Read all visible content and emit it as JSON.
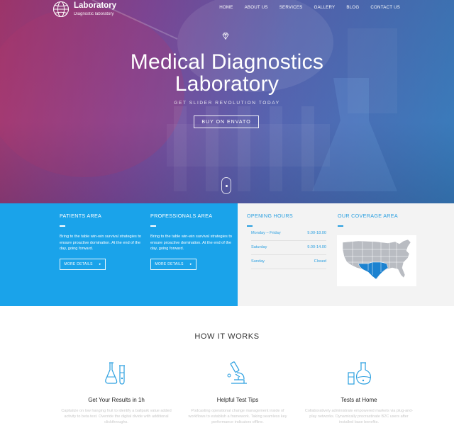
{
  "header": {
    "logo_title": "Laboratory",
    "logo_subtitle": "Diagnostic laboratory",
    "nav": [
      "HOME",
      "ABOUT US",
      "SERVICES",
      "GALLERY",
      "BLOG",
      "CONTACT US"
    ]
  },
  "hero": {
    "title_line1": "Medical Diagnostics",
    "title_line2": "Laboratory",
    "subtitle": "GET SLIDER REVOLUTION TODAY",
    "button": "BUY ON ENVATO"
  },
  "patients": {
    "title": "PATIENTS AREA",
    "text": "Bring to the table win-win survival strategies to ensure proactive domination. At the end of the day, going forward.",
    "button": "MORE DETAILS"
  },
  "professionals": {
    "title": "PROFESSIONALS AREA",
    "text": "Bring to the table win-win survival strategies to ensure proactive domination. At the end of the day, going forward.",
    "button": "MORE DETAILS"
  },
  "hours": {
    "title": "OPENING HOURS",
    "rows": [
      {
        "day": "Monday – Friday",
        "time": "9.00-18.00"
      },
      {
        "day": "Saturday",
        "time": "9.00-14.00"
      },
      {
        "day": "Sunday",
        "time": "Closed"
      }
    ]
  },
  "coverage": {
    "title": "OUR COVERAGE AREA"
  },
  "how": {
    "title": "HOW IT WORKS",
    "features": [
      {
        "title": "Get Your Results in 1h",
        "text": "Capitalize on low hanging fruit to identify a ballpark value added activity to beta test. Override the digital divide with additional clickthroughs."
      },
      {
        "title": "Helpful Test Tips",
        "text": "Podcasting operational change management inside of workflows to establish a framework. Taking seamless key performance indicators offline."
      },
      {
        "title": "Tests at Home",
        "text": "Collaboratively administrate empowered markets via plug-and-play networks. Dynamically procrastinate B2C users after installed base benefits."
      }
    ]
  },
  "colors": {
    "accent_blue": "#1aa3ea",
    "panel_gray": "#f3f3f3",
    "icon_blue": "#2a9fe0"
  }
}
